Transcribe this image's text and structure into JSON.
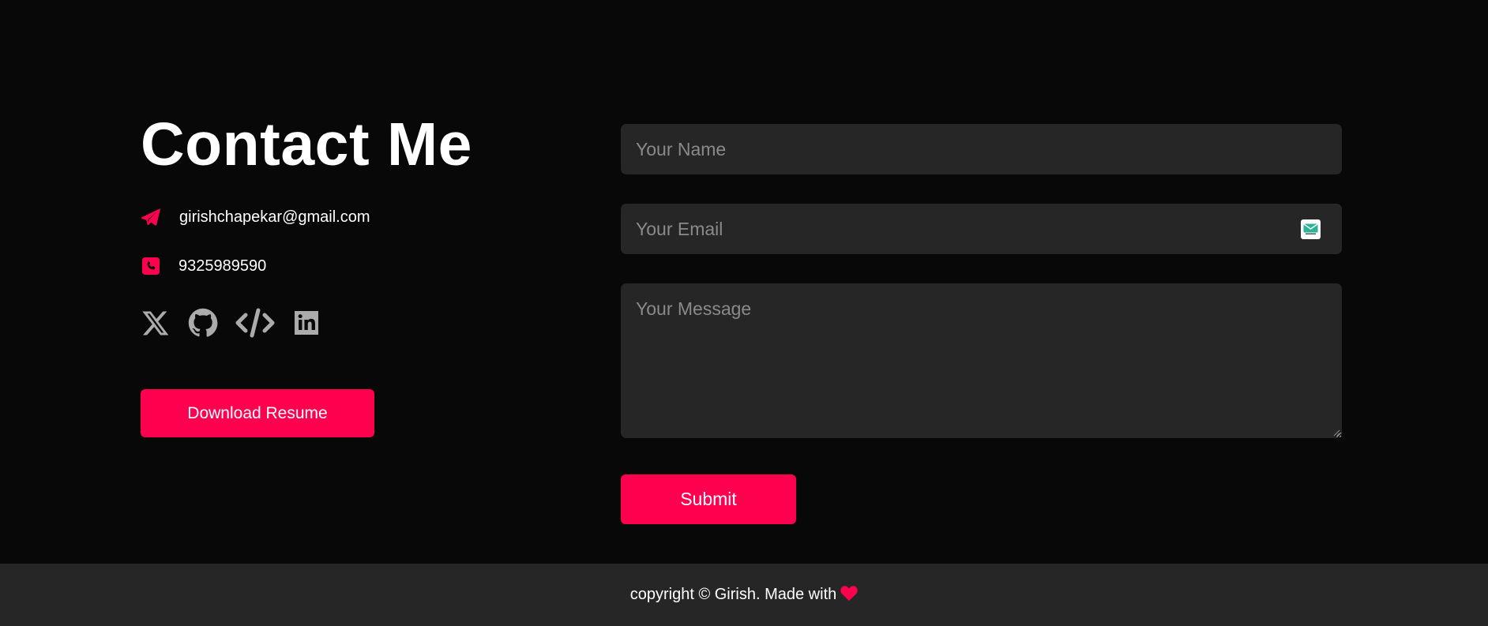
{
  "contact": {
    "title": "Contact Me",
    "email": {
      "icon": "paper-plane-icon",
      "text": "girishchapekar@gmail.com"
    },
    "phone": {
      "icon": "phone-square-icon",
      "text": "9325989590"
    },
    "socials": [
      {
        "icon": "x-twitter-icon"
      },
      {
        "icon": "github-icon"
      },
      {
        "icon": "code-icon"
      },
      {
        "icon": "linkedin-icon"
      }
    ],
    "resume_button": "Download Resume"
  },
  "form": {
    "name_placeholder": "Your Name",
    "email_placeholder": "Your Email",
    "email_badge_icon": "envelope-badge-icon",
    "message_placeholder": "Your Message",
    "submit_label": "Submit"
  },
  "footer": {
    "text": "copyright © Girish. Made with",
    "icon": "heart-icon"
  },
  "colors": {
    "background": "#080808",
    "panel": "#262626",
    "accent": "#ff004f",
    "icon_gray": "#ababab",
    "text": "#ffffff",
    "placeholder": "#8a8a8a"
  }
}
